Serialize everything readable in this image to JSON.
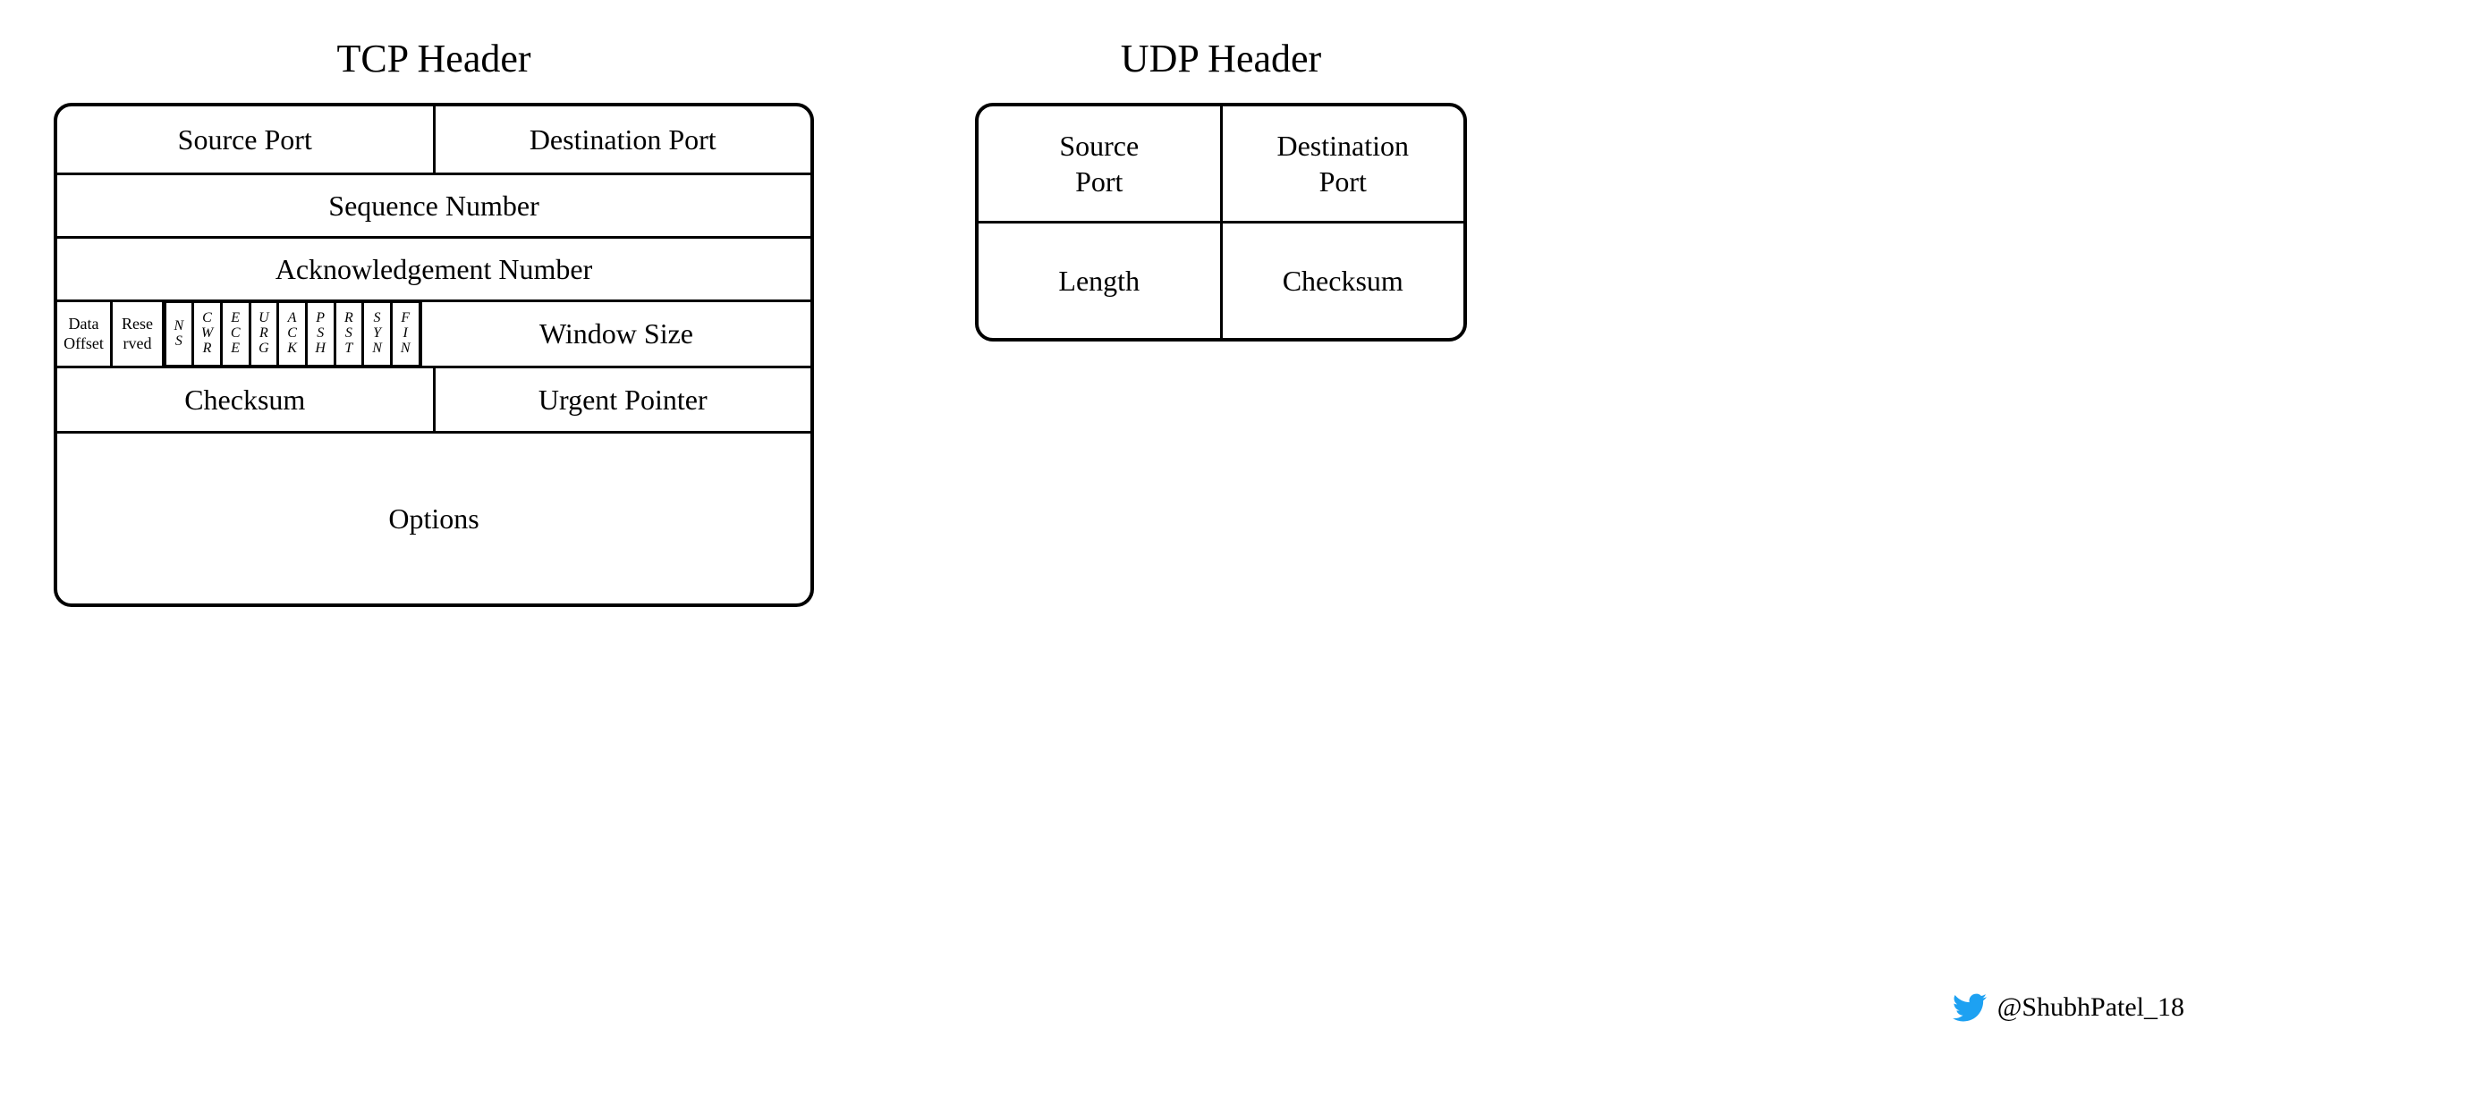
{
  "tcp": {
    "title": "TCP Header",
    "source_port": "Source Port",
    "destination_port": "Destination Port",
    "sequence_number": "Sequence Number",
    "ack_number": "Acknowledgement Number",
    "data_offset": "Data Offset",
    "reserved": "Rese rved",
    "flags": {
      "ns": [
        "N",
        "S"
      ],
      "cwr": [
        "C",
        "W",
        "R"
      ],
      "ece": [
        "E",
        "C",
        "E"
      ],
      "urg": [
        "U",
        "R",
        "G"
      ],
      "ack": [
        "A",
        "C",
        "K"
      ],
      "psh": [
        "P",
        "S",
        "H"
      ],
      "rst": [
        "R",
        "S",
        "T"
      ],
      "syn": [
        "S",
        "Y",
        "N"
      ],
      "fin": [
        "F",
        "I",
        "N"
      ]
    },
    "window_size": "Window Size",
    "checksum": "Checksum",
    "urgent_pointer": "Urgent Pointer",
    "options": "Options"
  },
  "udp": {
    "title": "UDP Header",
    "source_port": "Source Port",
    "destination_port": "Destination Port",
    "length": "Length",
    "checksum": "Checksum"
  },
  "credit": {
    "handle": "@ShubhPatel_18"
  }
}
